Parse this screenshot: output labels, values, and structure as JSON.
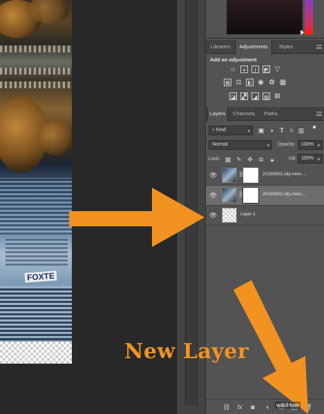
{
  "canvas": {
    "sign_text": "FOXTE"
  },
  "panels": {
    "top_tabs": [
      {
        "label": "Libraries"
      },
      {
        "label": "Adjustments",
        "active": true
      },
      {
        "label": "Styles"
      }
    ],
    "adjustments": {
      "title": "Add an adjustment",
      "icons": [
        "brightness-contrast",
        "levels",
        "curves",
        "exposure",
        "vibrance",
        "hue-saturation",
        "color-balance",
        "black-white",
        "photo-filter",
        "channel-mixer",
        "color-lookup",
        "invert",
        "posterize",
        "threshold",
        "selective-color",
        "gradient-map"
      ]
    },
    "layer_tabs": [
      {
        "label": "Layers",
        "active": true
      },
      {
        "label": "Channels"
      },
      {
        "label": "Paths"
      }
    ],
    "filter": {
      "kind": "Kind"
    },
    "blend_mode": "Normal",
    "opacity": {
      "label": "Opacity:",
      "value": "100%"
    },
    "lock": {
      "label": "Lock:"
    },
    "fill": {
      "label": "Fill:",
      "value": "100%"
    },
    "layers": [
      {
        "name": "20150502-city-river-...",
        "selected": false,
        "has_mask": true
      },
      {
        "name": "20150502-city-river-...",
        "selected": true,
        "has_mask": true
      },
      {
        "name": "Layer 1",
        "selected": false,
        "has_mask": false
      }
    ]
  },
  "annotation": {
    "new_layer_label": "New Layer",
    "arrow_color": "#f29321"
  },
  "watermark": "wikiHow"
}
